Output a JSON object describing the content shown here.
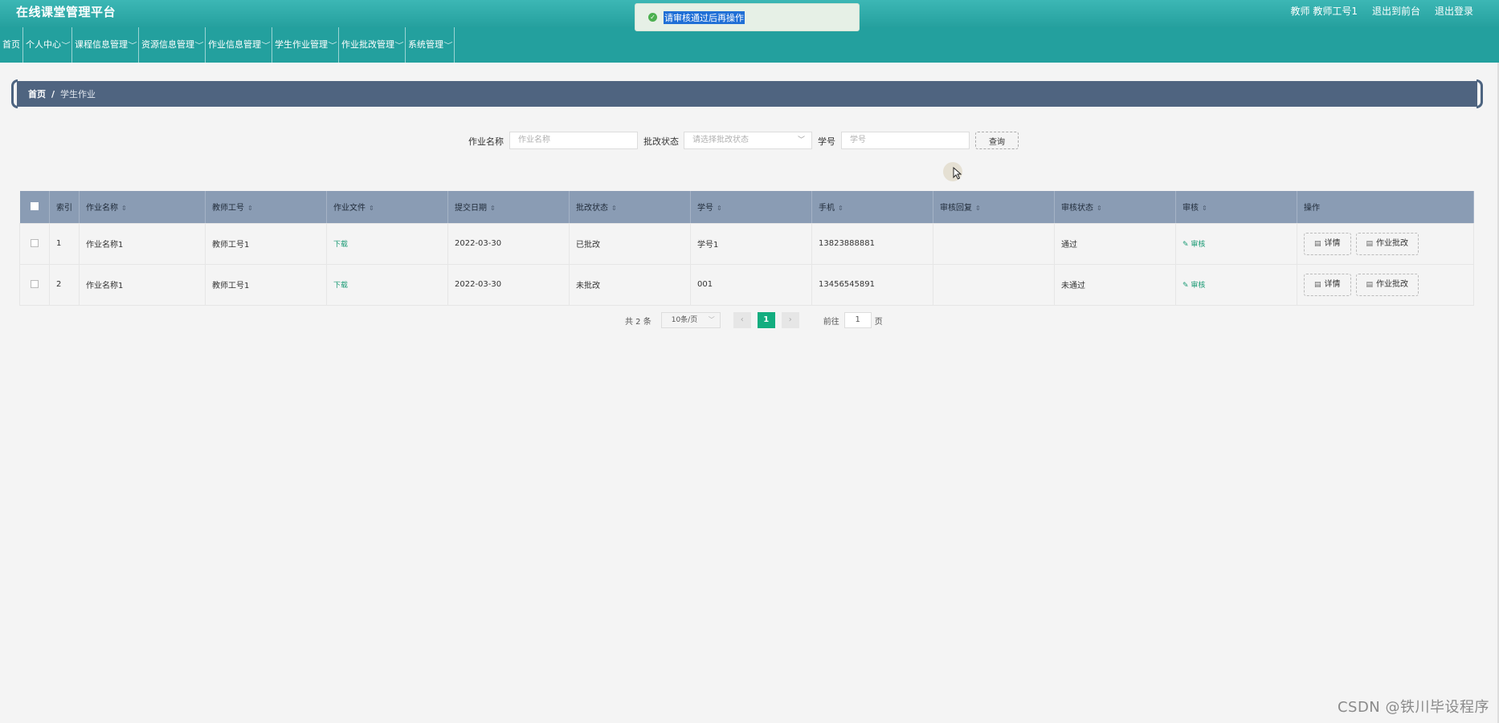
{
  "header": {
    "title": "在线课堂管理平台",
    "role_label": "教师 教师工号1",
    "back_to_front": "退出到前台",
    "logout": "退出登录"
  },
  "toast": {
    "message": "请审核通过后再操作",
    "icon": "check-circle-icon",
    "color": "#4caf50"
  },
  "nav": [
    {
      "label": "首页",
      "has_dropdown": false
    },
    {
      "label": "个人中心",
      "has_dropdown": true
    },
    {
      "label": "课程信息管理",
      "has_dropdown": true
    },
    {
      "label": "资源信息管理",
      "has_dropdown": true
    },
    {
      "label": "作业信息管理",
      "has_dropdown": true
    },
    {
      "label": "学生作业管理",
      "has_dropdown": true
    },
    {
      "label": "作业批改管理",
      "has_dropdown": true
    },
    {
      "label": "系统管理",
      "has_dropdown": true
    }
  ],
  "breadcrumb": {
    "home": "首页",
    "separator": "/",
    "current": "学生作业"
  },
  "search": {
    "name_label": "作业名称",
    "name_placeholder": "作业名称",
    "status_label": "批改状态",
    "status_placeholder": "请选择批改状态",
    "student_label": "学号",
    "student_placeholder": "学号",
    "query_button": "查询"
  },
  "table": {
    "columns": [
      "索引",
      "作业名称",
      "教师工号",
      "作业文件",
      "提交日期",
      "批改状态",
      "学号",
      "手机",
      "审核回复",
      "审核状态",
      "审核",
      "操作"
    ],
    "rows": [
      {
        "index": "1",
        "name": "作业名称1",
        "teacher": "教师工号1",
        "file": "下载",
        "date": "2022-03-30",
        "grading": "已批改",
        "student": "学号1",
        "phone": "13823888881",
        "reply": "",
        "review_status": "通过",
        "review": "审核",
        "detail": "详情",
        "grade": "作业批改"
      },
      {
        "index": "2",
        "name": "作业名称1",
        "teacher": "教师工号1",
        "file": "下载",
        "date": "2022-03-30",
        "grading": "未批改",
        "student": "001",
        "phone": "13456545891",
        "reply": "",
        "review_status": "未通过",
        "review": "审核",
        "detail": "详情",
        "grade": "作业批改"
      }
    ]
  },
  "pagination": {
    "total": "共 2 条",
    "page_size": "10条/页",
    "current_page": "1",
    "goto_label": "前往",
    "goto_value": "1",
    "page_suffix": "页"
  },
  "watermark": "CSDN @铁川毕设程序",
  "colors": {
    "header": "#25a09e",
    "breadcrumb": "#4f6480",
    "table_header": "#8a9cb4",
    "accent": "#13ad7f"
  }
}
